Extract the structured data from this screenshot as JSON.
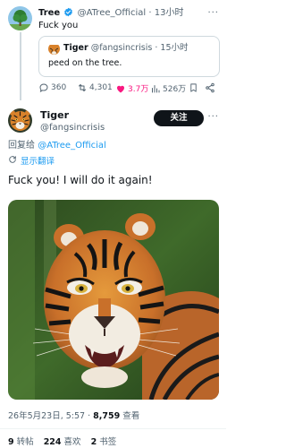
{
  "parent_tweet": {
    "name": "Tree",
    "handle": "@ATree_Official",
    "time": "· 13小时",
    "text": "Fuck you",
    "quote": {
      "name": "Tiger",
      "handle": "@fangsincrisis",
      "time": "· 15小时",
      "text": "peed on the tree."
    },
    "actions": {
      "replies": "360",
      "retweets": "4,301",
      "likes": "3.7万",
      "views": "526万"
    },
    "colors": {
      "like_active": "#f91880",
      "verified": "#1d9bf0"
    }
  },
  "main_tweet": {
    "name": "Tiger",
    "handle": "@fangsincrisis",
    "follow_label": "关注",
    "reply_prefix": "回复给 ",
    "reply_to": "@ATree_Official",
    "translate_label": "显示翻译",
    "text": "Fuck you! I will do it again!",
    "timestamp_prefix": "26年5月23日, 5:57 · ",
    "views_count": "8,759",
    "views_label": " 查看",
    "stats": {
      "retweets_count": "9",
      "retweets_label": " 转帖",
      "likes_count": "224",
      "likes_label": " 喜欢",
      "bookmarks_count": "2",
      "bookmarks_label": " 书签"
    }
  },
  "icons": {
    "verified": "verified-badge-icon",
    "reply": "reply-icon",
    "retweet": "retweet-icon",
    "like": "heart-icon",
    "views": "views-icon",
    "bookmark": "bookmark-icon",
    "share": "share-icon",
    "translate": "translate-icon",
    "more": "more-icon"
  },
  "accent": "#1d9bf0"
}
